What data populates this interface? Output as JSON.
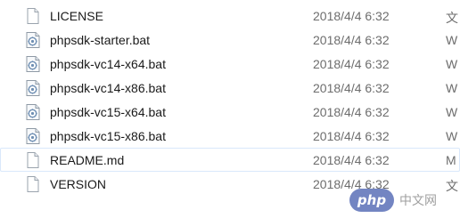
{
  "files": [
    {
      "name": "LICENSE",
      "date": "2018/4/4 6:32",
      "type": "文",
      "icon": "blank-file-icon"
    },
    {
      "name": "phpsdk-starter.bat",
      "date": "2018/4/4 6:32",
      "type": "W",
      "icon": "batch-file-icon"
    },
    {
      "name": "phpsdk-vc14-x64.bat",
      "date": "2018/4/4 6:32",
      "type": "W",
      "icon": "batch-file-icon"
    },
    {
      "name": "phpsdk-vc14-x86.bat",
      "date": "2018/4/4 6:32",
      "type": "W",
      "icon": "batch-file-icon"
    },
    {
      "name": "phpsdk-vc15-x64.bat",
      "date": "2018/4/4 6:32",
      "type": "W",
      "icon": "batch-file-icon"
    },
    {
      "name": "phpsdk-vc15-x86.bat",
      "date": "2018/4/4 6:32",
      "type": "W",
      "icon": "batch-file-icon"
    },
    {
      "name": "README.md",
      "date": "2018/4/4 6:32",
      "type": "M",
      "icon": "blank-file-icon",
      "selected": true
    },
    {
      "name": "VERSION",
      "date": "2018/4/4 6:32",
      "type": "文",
      "icon": "blank-file-icon"
    }
  ],
  "watermark": {
    "logo_text": "php",
    "site_text": "中文网"
  },
  "colors": {
    "selection_border": "#d9e8fb",
    "date_text": "#6d6d6d",
    "name_text": "#1a1a1a",
    "php_logo": "#6c7fbf"
  }
}
